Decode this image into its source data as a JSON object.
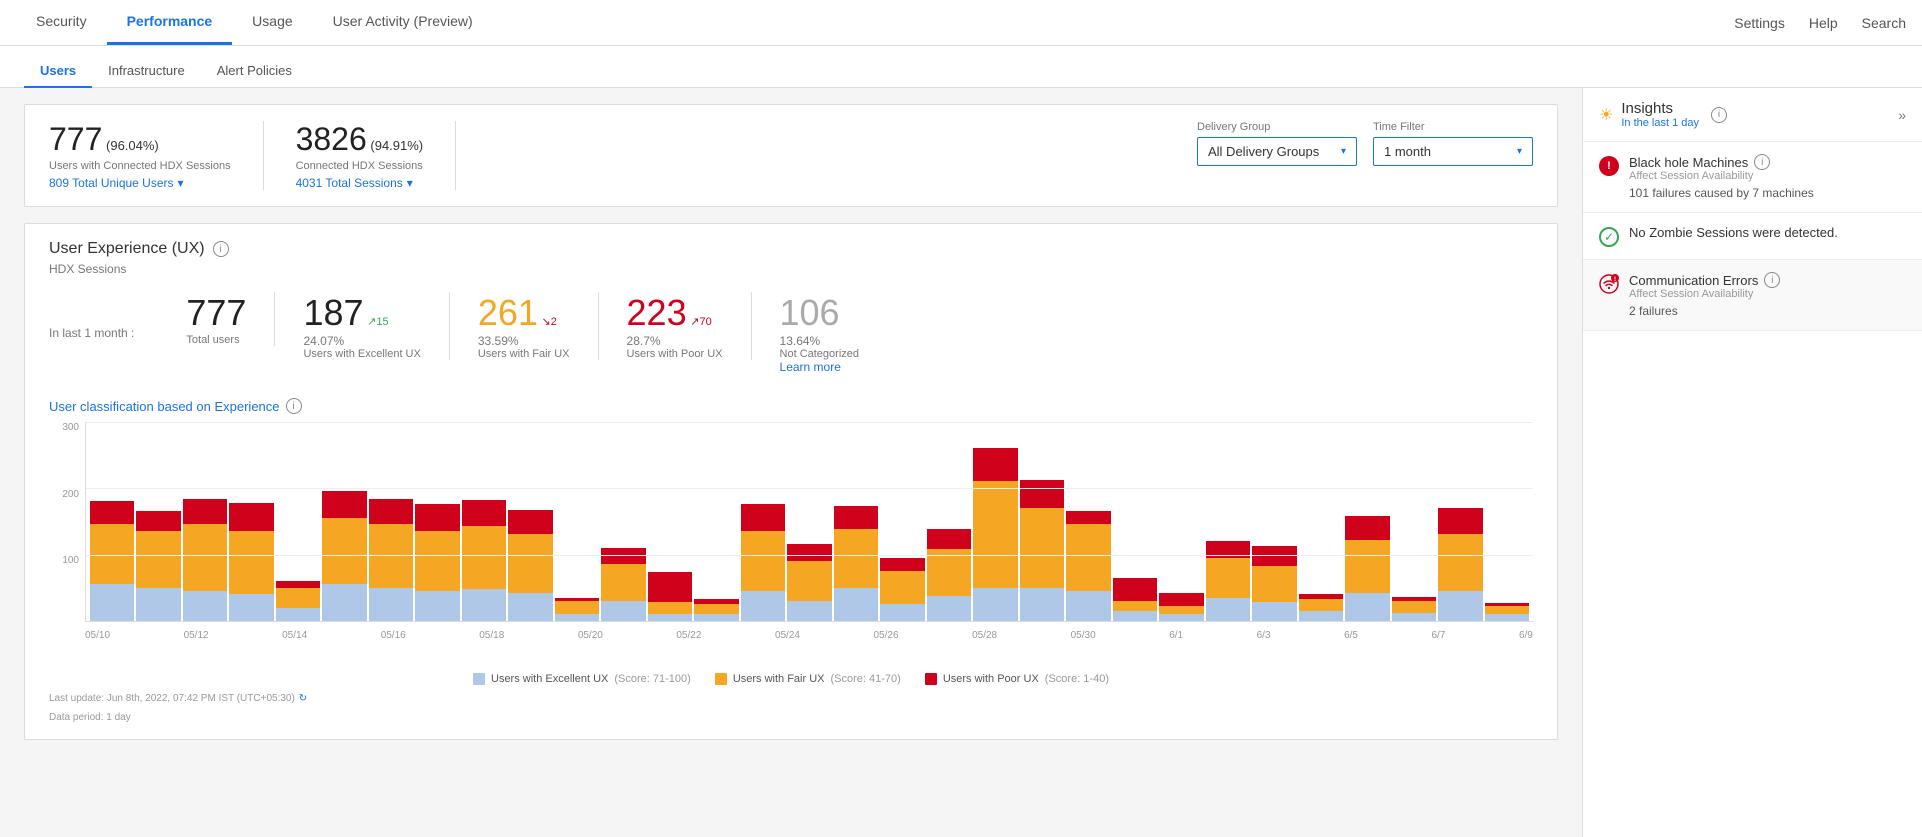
{
  "topNav": {
    "tabs": [
      {
        "id": "security",
        "label": "Security",
        "active": false
      },
      {
        "id": "performance",
        "label": "Performance",
        "active": true
      },
      {
        "id": "usage",
        "label": "Usage",
        "active": false
      },
      {
        "id": "user-activity",
        "label": "User Activity (Preview)",
        "active": false
      }
    ],
    "rightItems": [
      {
        "id": "settings",
        "label": "Settings"
      },
      {
        "id": "help",
        "label": "Help"
      },
      {
        "id": "search",
        "label": "Search"
      }
    ]
  },
  "subNav": {
    "tabs": [
      {
        "id": "users",
        "label": "Users",
        "active": true
      },
      {
        "id": "infrastructure",
        "label": "Infrastructure",
        "active": false
      },
      {
        "id": "alert-policies",
        "label": "Alert Policies",
        "active": false
      }
    ]
  },
  "stats": {
    "connectedUsers": {
      "number": "777",
      "pct": "(96.04%)",
      "label": "Users with Connected HDX Sessions",
      "linkText": "809 Total Unique Users"
    },
    "connectedSessions": {
      "number": "3826",
      "pct": "(94.91%)",
      "label": "Connected HDX Sessions",
      "linkText": "4031 Total Sessions"
    }
  },
  "filters": {
    "deliveryGroup": {
      "label": "Delivery Group",
      "value": "All Delivery Groups"
    },
    "timeFilter": {
      "label": "Time Filter",
      "value": "1 month"
    }
  },
  "uxSection": {
    "title": "User Experience (UX)",
    "subtitle": "HDX Sessions",
    "period": "In last 1 month :",
    "stats": {
      "total": {
        "number": "777",
        "label": "Total users"
      },
      "excellent": {
        "number": "187",
        "delta": "↗15",
        "deltaType": "up",
        "pct": "24.07%",
        "label": "Users with Excellent UX"
      },
      "fair": {
        "number": "261",
        "delta": "↘2",
        "deltaType": "down",
        "pct": "33.59%",
        "label": "Users with Fair UX"
      },
      "poor": {
        "number": "223",
        "delta": "↗70",
        "deltaType": "up",
        "pct": "28.7%",
        "label": "Users with Poor UX"
      },
      "notCategorized": {
        "number": "106",
        "pct": "13.64%",
        "label": "Not Categorized",
        "learnMore": "Learn more"
      }
    },
    "chart": {
      "title": "User classification based on Experience",
      "yLabels": [
        "300",
        "200",
        "100",
        ""
      ],
      "xLabels": [
        "05/10",
        "05/12",
        "05/14",
        "05/16",
        "05/18",
        "05/20",
        "05/22",
        "05/24",
        "05/26",
        "05/28",
        "05/30",
        "6/1",
        "6/3",
        "6/5",
        "6/7",
        "6/9"
      ],
      "legend": [
        {
          "label": "Users with Excellent UX",
          "color": "#b0c8e8",
          "scoreRange": "(Score: 71-100)"
        },
        {
          "label": "Users with Fair UX",
          "color": "#f5a623",
          "scoreRange": "(Score: 41-70)"
        },
        {
          "label": "Users with Poor UX",
          "color": "#d0021b",
          "scoreRange": "(Score: 1-40)"
        }
      ],
      "footer": {
        "lastUpdate": "Last update: Jun 8th, 2022, 07:42 PM IST (UTC+05:30)",
        "period": "Data period: 1 day"
      }
    }
  },
  "insights": {
    "title": "Insights",
    "subtitle": "In the last 1 day",
    "items": [
      {
        "id": "black-hole",
        "type": "error",
        "title": "Black hole Machines",
        "subtitle": "Affect Session Availability",
        "detail": "101 failures caused by 7 machines"
      },
      {
        "id": "zombie-sessions",
        "type": "ok",
        "title": "No Zombie Sessions were detected.",
        "subtitle": "",
        "detail": ""
      },
      {
        "id": "comm-errors",
        "type": "error",
        "title": "Communication Errors",
        "subtitle": "Affect Session Availability",
        "detail": "2 failures"
      }
    ]
  }
}
